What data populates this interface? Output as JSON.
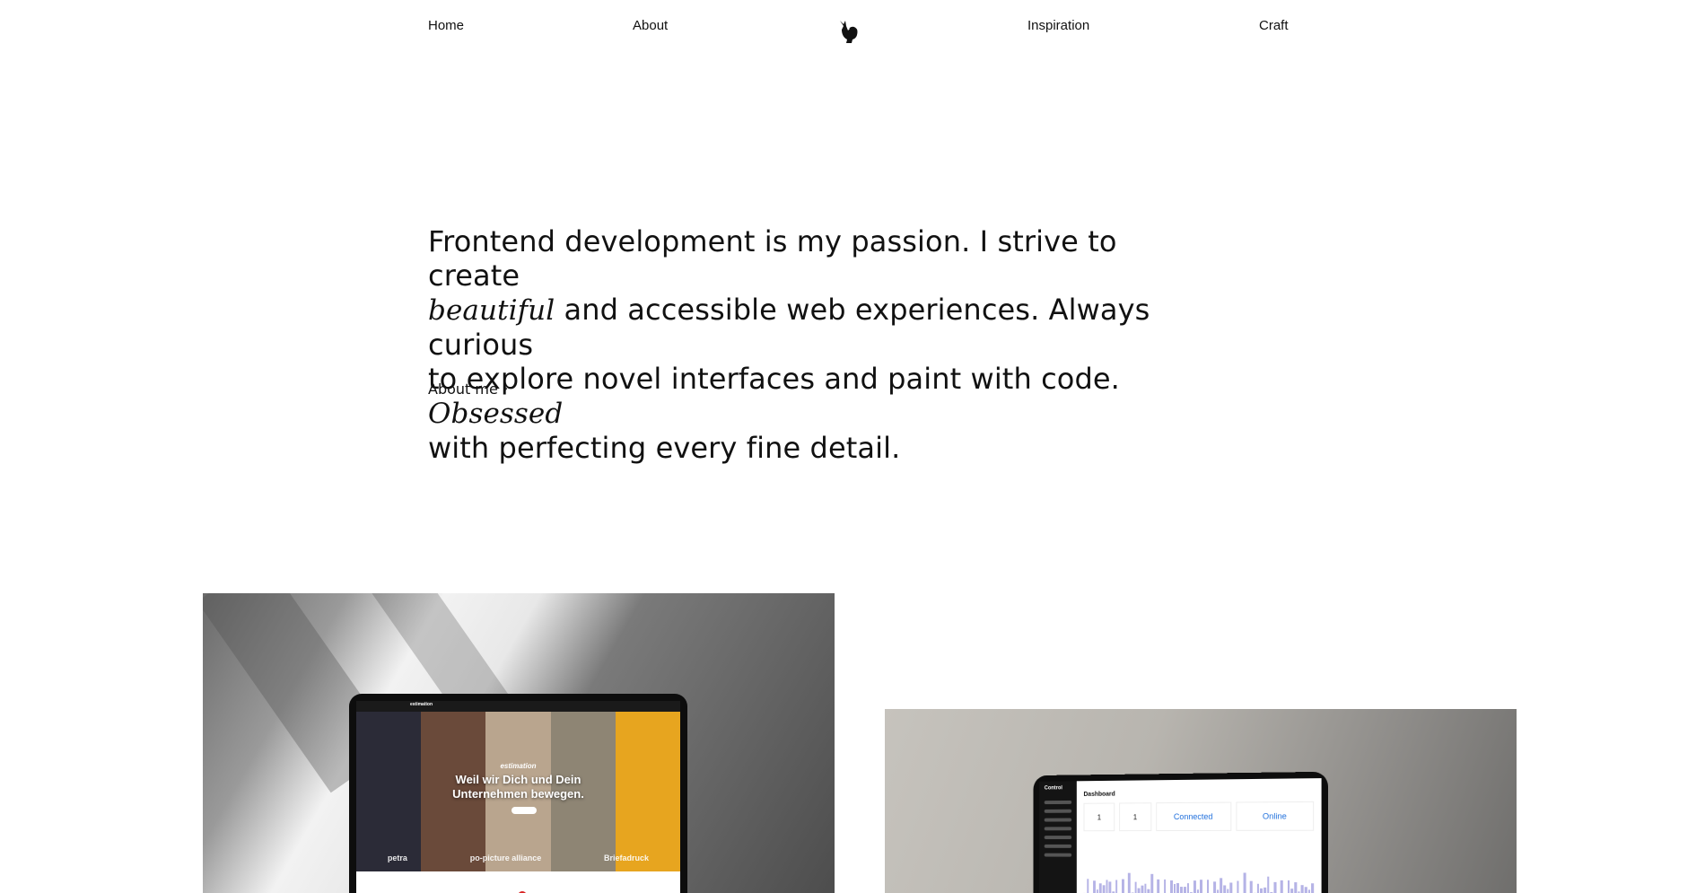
{
  "nav": {
    "home": "Home",
    "about": "About",
    "inspiration": "Inspiration",
    "craft": "Craft",
    "logo_icon": "fox-silhouette-icon"
  },
  "hero": {
    "line1": "Frontend development is my passion. I strive to create",
    "em1": "beautiful",
    "line2": " and accessible web experiences. Always curious",
    "line3": "to explore novel interfaces and paint with code. ",
    "em2": "Obsessed",
    "line4": "with perfecting every fine detail.",
    "cta_label": "About me",
    "cta_icon": "chevron-right-icon"
  },
  "projects": [
    {
      "screen": {
        "brand": "estimation",
        "tagline": "estimation",
        "headline_1": "Weil wir Dich und Dein",
        "headline_2": "Unternehmen bewegen.",
        "logos": [
          "petra",
          "po-picture alliance",
          "Briefadruck"
        ]
      }
    },
    {
      "screen": {
        "brand": "Control",
        "title": "Dashboard",
        "tiles": [
          "1",
          "1",
          "Connected",
          "Online"
        ]
      }
    }
  ],
  "colors": {
    "text": "#111111",
    "background": "#ffffff",
    "accent_blue": "#1f6fdc",
    "chart_bars": "#b5b3e6",
    "dot_red": "#d92424"
  }
}
